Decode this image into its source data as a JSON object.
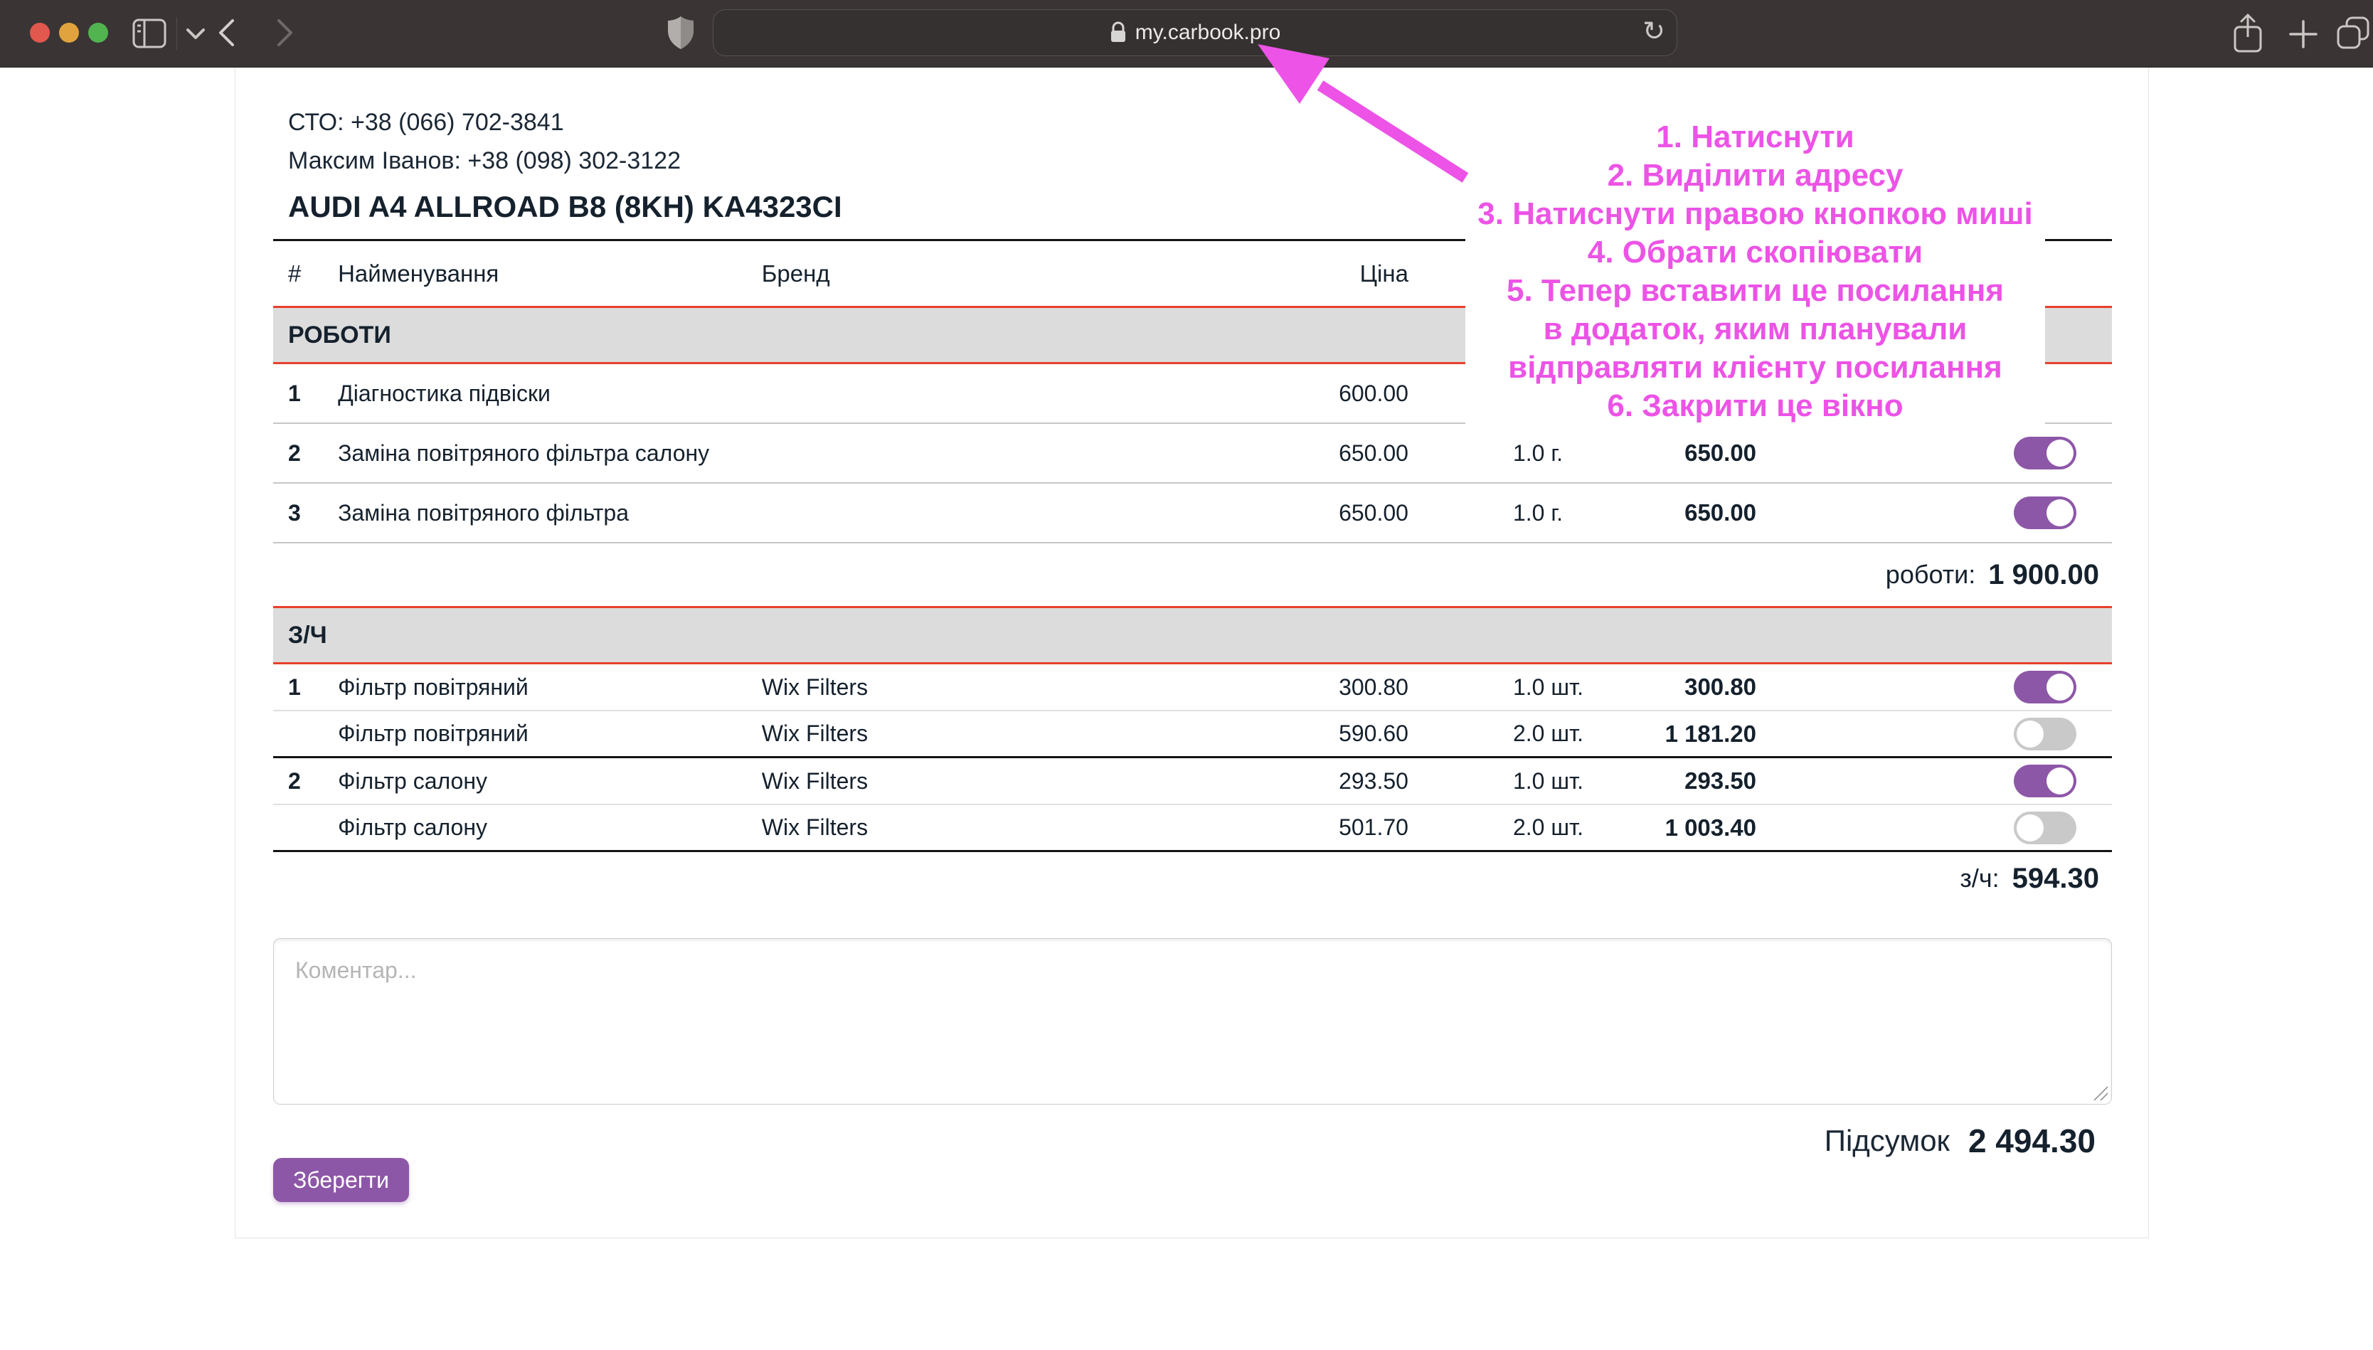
{
  "browser": {
    "url": "my.carbook.pro",
    "reload_glyph": "↻",
    "traffic_colors": {
      "close": "#e2574e",
      "minimize": "#e0a33e",
      "zoom": "#51b44f"
    }
  },
  "header": {
    "sto_phone": "СТО: +38 (066) 702-3841",
    "manager_phone": "Максим Іванов: +38 (098) 302-3122",
    "vehicle_title": "AUDI A4 ALLROAD B8 (8KH) KA4323CI"
  },
  "table": {
    "columns": [
      "#",
      "Найменування",
      "Бренд",
      "Ціна"
    ],
    "sections": [
      {
        "title": "РОБОТИ",
        "kind": "work",
        "rows": [
          {
            "num": "1",
            "name": "Діагностика підвіски",
            "brand": "",
            "price": "600.00",
            "qty": "",
            "sum": "",
            "toggle": "hidden",
            "divider": "gray"
          },
          {
            "num": "2",
            "name": "Заміна повітряного фільтра салону",
            "brand": "",
            "price": "650.00",
            "qty": "1.0 г.",
            "sum": "650.00",
            "toggle": "on",
            "divider": "gray"
          },
          {
            "num": "3",
            "name": "Заміна повітряного фільтра",
            "brand": "",
            "price": "650.00",
            "qty": "1.0 г.",
            "sum": "650.00",
            "toggle": "on",
            "divider": "gray"
          }
        ],
        "total_label": "роботи:",
        "total_value": "1 900.00"
      },
      {
        "title": "З/Ч",
        "kind": "part",
        "rows": [
          {
            "num": "1",
            "name": "Фільтр повітряний",
            "brand": "Wix Filters",
            "price": "300.80",
            "qty": "1.0 шт.",
            "sum": "300.80",
            "toggle": "on",
            "divider": "light"
          },
          {
            "num": "",
            "name": "Фільтр повітряний",
            "brand": "Wix Filters",
            "price": "590.60",
            "qty": "2.0 шт.",
            "sum": "1 181.20",
            "toggle": "off",
            "divider": "dark"
          },
          {
            "num": "2",
            "name": "Фільтр салону",
            "brand": "Wix Filters",
            "price": "293.50",
            "qty": "1.0 шт.",
            "sum": "293.50",
            "toggle": "on",
            "divider": "light"
          },
          {
            "num": "",
            "name": "Фільтр салону",
            "brand": "Wix Filters",
            "price": "501.70",
            "qty": "2.0 шт.",
            "sum": "1 003.40",
            "toggle": "off",
            "divider": "dark"
          }
        ],
        "total_label": "з/ч:",
        "total_value": "594.30"
      }
    ]
  },
  "comment": {
    "placeholder": "Коментар..."
  },
  "summary": {
    "label": "Підсумок",
    "value": "2 494.30"
  },
  "save_button_label": "Зберегти",
  "annotation": {
    "color": "#ec53e6",
    "lines": [
      "1. Натиснути",
      "2. Виділити адресу",
      "3. Натиснути правою кнопкою миші",
      "4. Обрати скопіювати",
      "5. Тепер вставити це посилання",
      "в додаток, яким планували",
      "відправляти клієнту посилання",
      "6. Закрити це вікно"
    ]
  },
  "colors": {
    "accent_purple": "#8d57a8",
    "section_border_red": "#e8402c",
    "band_gray": "#dcdcdc"
  }
}
